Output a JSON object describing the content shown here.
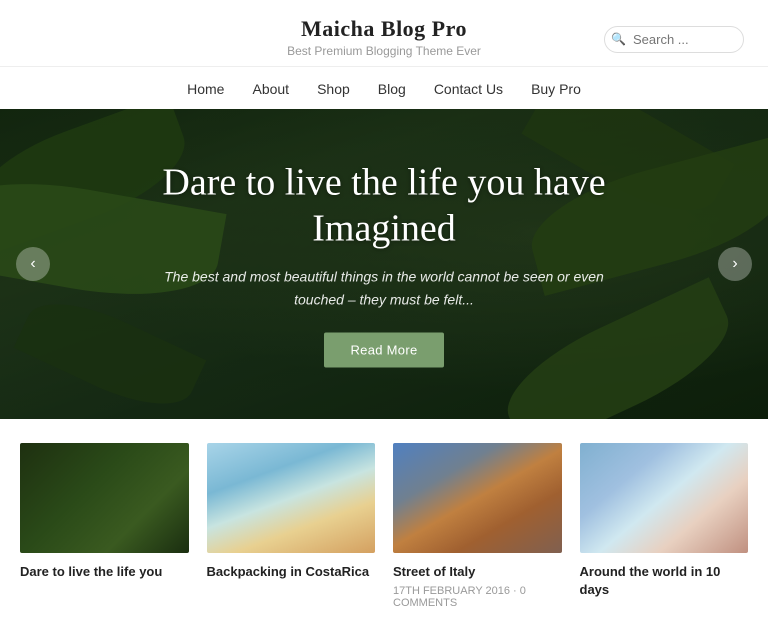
{
  "header": {
    "site_title": "Maicha Blog Pro",
    "site_tagline": "Best Premium Blogging Theme Ever",
    "search_placeholder": "Search ..."
  },
  "nav": {
    "items": [
      {
        "label": "Home",
        "href": "#"
      },
      {
        "label": "About",
        "href": "#"
      },
      {
        "label": "Shop",
        "href": "#"
      },
      {
        "label": "Blog",
        "href": "#"
      },
      {
        "label": "Contact Us",
        "href": "#"
      },
      {
        "label": "Buy Pro",
        "href": "#"
      }
    ]
  },
  "hero": {
    "title": "Dare to live the life you have Imagined",
    "subtitle": "The best and most beautiful things in the world cannot be seen or even touched – they must be felt...",
    "button_label": "Read More",
    "arrow_left": "‹",
    "arrow_right": "›"
  },
  "blog": {
    "cards": [
      {
        "title": "Dare to live the life you",
        "meta": "",
        "thumb_class": "thumb-1"
      },
      {
        "title": "Backpacking in CostaRica",
        "meta": "",
        "thumb_class": "thumb-2"
      },
      {
        "title": "Street of Italy",
        "meta": "17TH FEBRUARY 2016 · 0 COMMENTS",
        "thumb_class": "thumb-3"
      },
      {
        "title": "Around the world in 10 days",
        "meta": "",
        "thumb_class": "thumb-4"
      }
    ]
  }
}
